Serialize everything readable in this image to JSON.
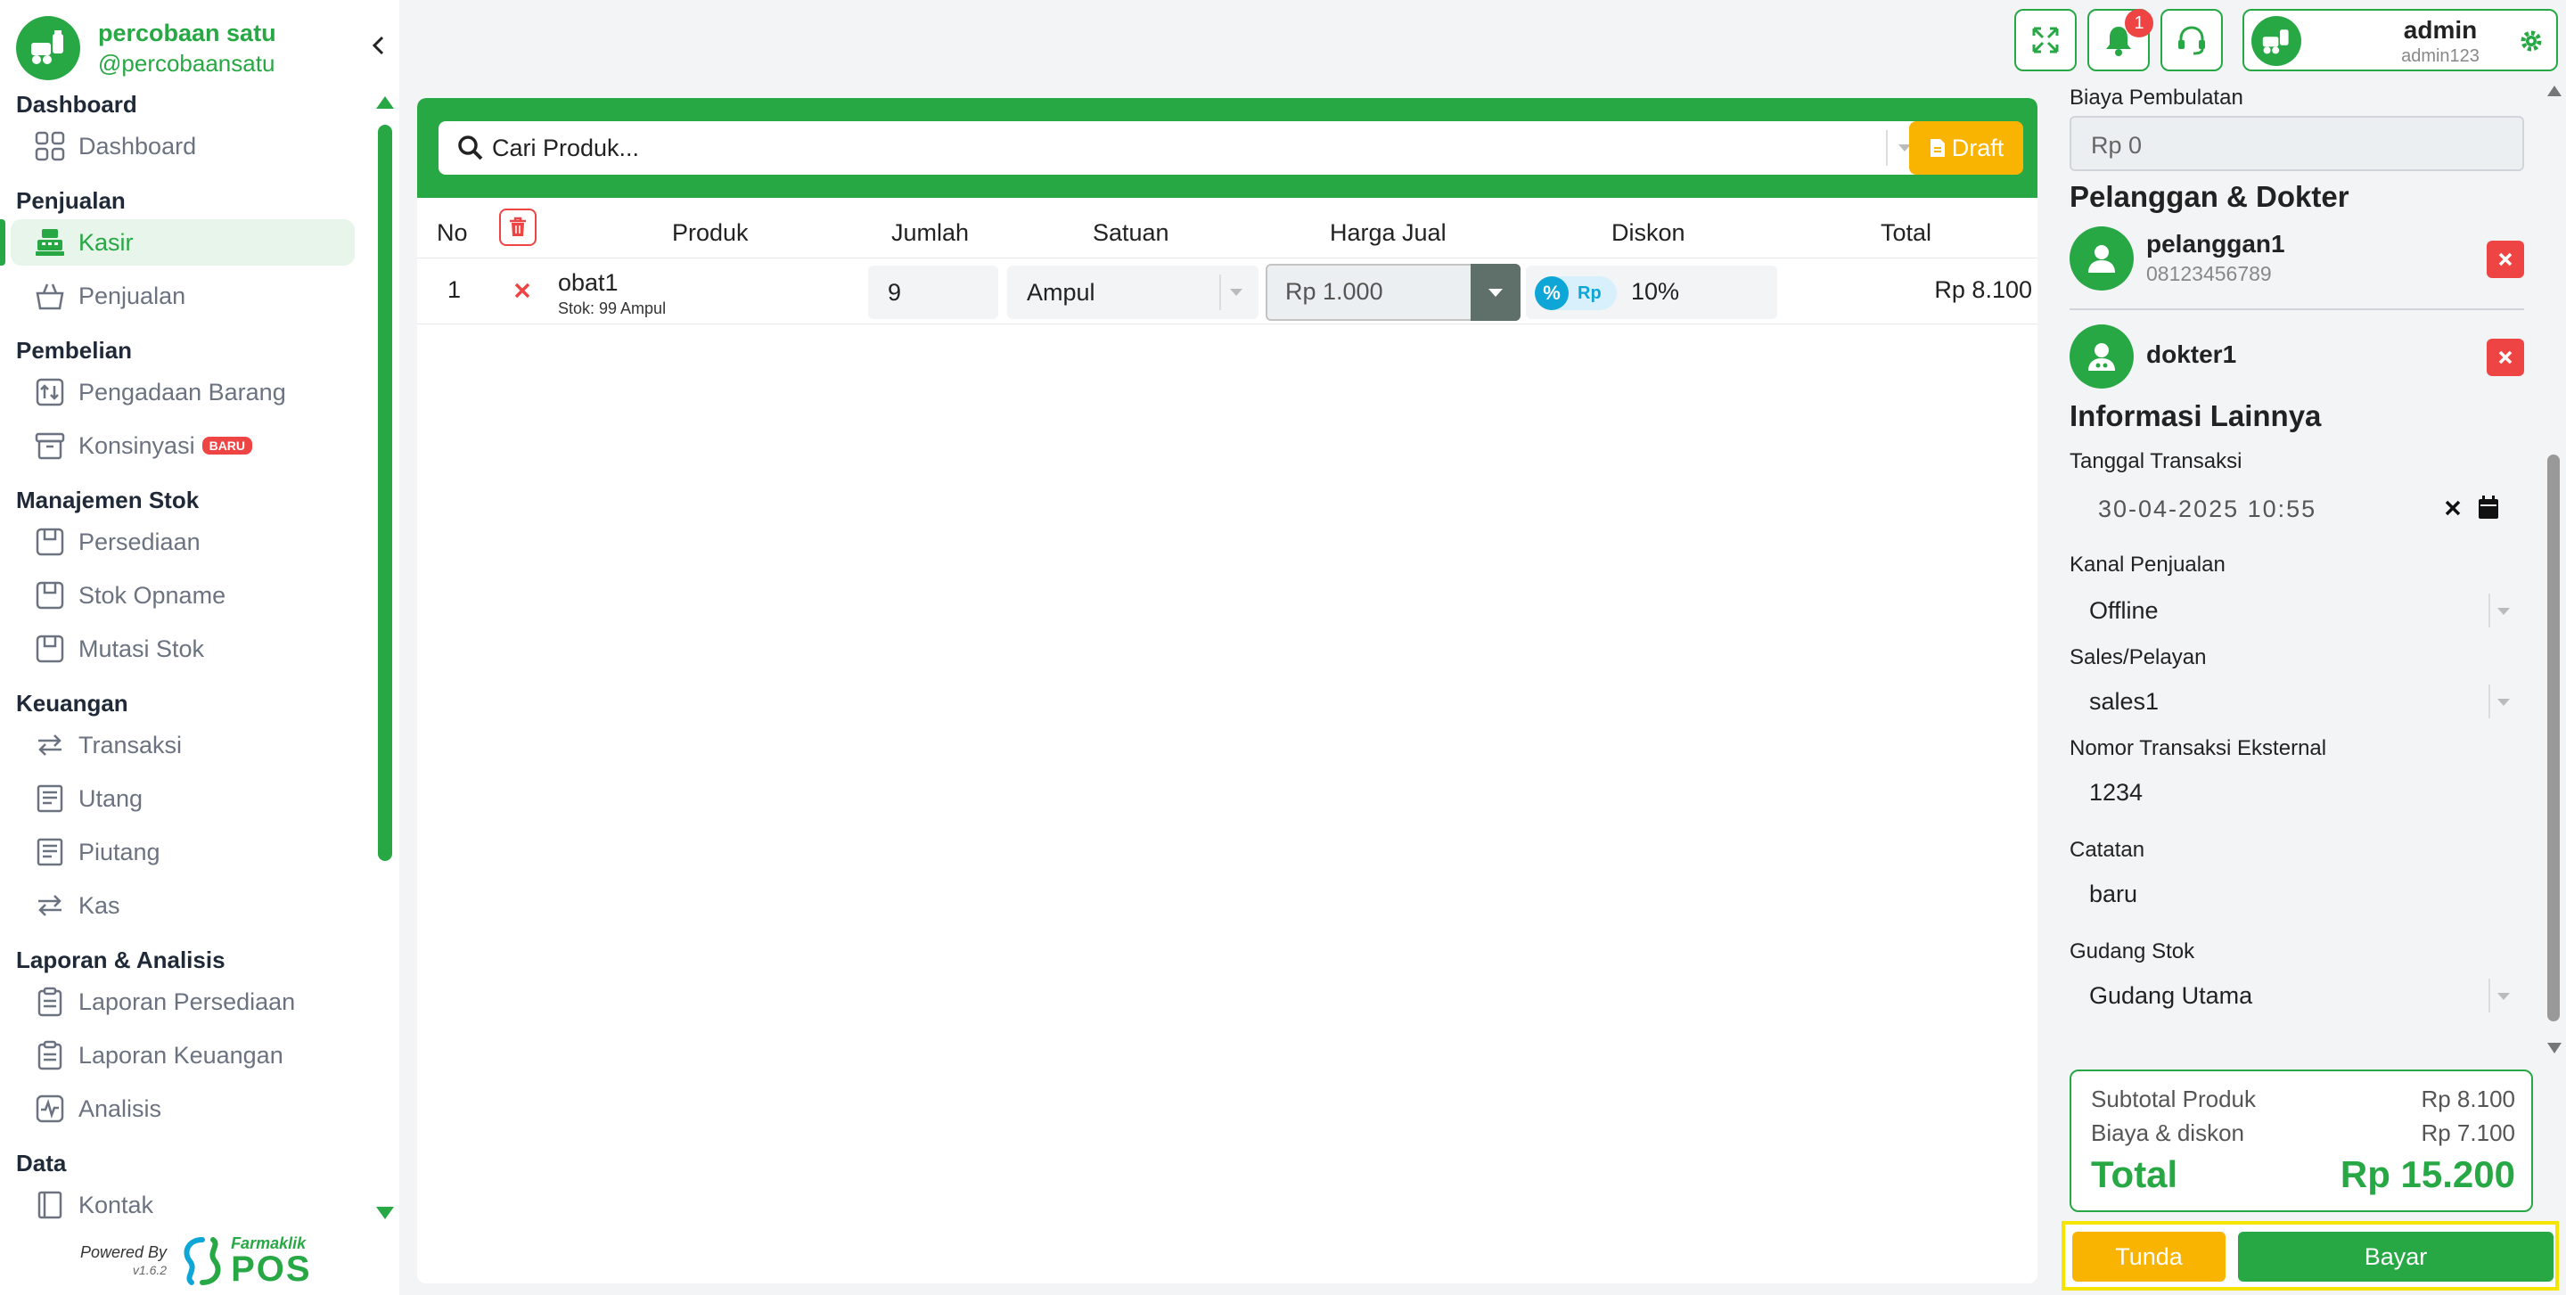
{
  "brand": {
    "name": "percobaan satu",
    "handle": "@percobaansatu"
  },
  "colors": {
    "primary": "#27a844",
    "warning": "#f8b400",
    "danger": "#ef4444",
    "info": "#0ea5d7"
  },
  "sidebar": {
    "sections": [
      {
        "title": "Dashboard",
        "items": [
          {
            "label": "Dashboard",
            "icon": "grid-icon"
          }
        ]
      },
      {
        "title": "Penjualan",
        "items": [
          {
            "label": "Kasir",
            "icon": "cash-register-icon",
            "active": true
          },
          {
            "label": "Penjualan",
            "icon": "basket-icon"
          }
        ]
      },
      {
        "title": "Pembelian",
        "items": [
          {
            "label": "Pengadaan Barang",
            "icon": "procurement-icon"
          },
          {
            "label": "Konsinyasi",
            "icon": "archive-icon",
            "badge": "BARU"
          }
        ]
      },
      {
        "title": "Manajemen Stok",
        "items": [
          {
            "label": "Persediaan",
            "icon": "box-icon"
          },
          {
            "label": "Stok Opname",
            "icon": "box-icon"
          },
          {
            "label": "Mutasi Stok",
            "icon": "box-icon"
          }
        ]
      },
      {
        "title": "Keuangan",
        "items": [
          {
            "label": "Transaksi",
            "icon": "transfer-icon"
          },
          {
            "label": "Utang",
            "icon": "receipt-icon"
          },
          {
            "label": "Piutang",
            "icon": "receipt-icon"
          },
          {
            "label": "Kas",
            "icon": "transfer-icon"
          }
        ]
      },
      {
        "title": "Laporan & Analisis",
        "items": [
          {
            "label": "Laporan Persediaan",
            "icon": "clipboard-icon"
          },
          {
            "label": "Laporan Keuangan",
            "icon": "clipboard-icon"
          },
          {
            "label": "Analisis",
            "icon": "activity-icon"
          }
        ]
      },
      {
        "title": "Data",
        "items": [
          {
            "label": "Kontak",
            "icon": "contact-book-icon"
          }
        ]
      }
    ],
    "powered_by": "Powered By",
    "version": "v1.6.2",
    "product_small": "Farmaklik",
    "product_big": "POS"
  },
  "topbar": {
    "notification_count": "1",
    "user_name": "admin",
    "user_id": "admin123"
  },
  "search": {
    "placeholder": "Cari Produk...",
    "draft_label": "Draft"
  },
  "table": {
    "headers": {
      "no": "No",
      "produk": "Produk",
      "jumlah": "Jumlah",
      "satuan": "Satuan",
      "harga": "Harga Jual",
      "diskon": "Diskon",
      "total": "Total"
    },
    "rows": [
      {
        "no": "1",
        "name": "obat1",
        "stock": "Stok: 99 Ampul",
        "qty": "9",
        "unit": "Ampul",
        "price": "Rp 1.000",
        "discount_pct": "%",
        "discount_rp": "Rp",
        "discount": "10%",
        "total": "Rp 8.100"
      }
    ]
  },
  "right": {
    "rounding_label": "Biaya Pembulatan",
    "rounding_value": "Rp 0",
    "customers_title": "Pelanggan & Dokter",
    "customer": {
      "name": "pelanggan1",
      "phone": "08123456789"
    },
    "doctor": {
      "name": "dokter1"
    },
    "other_title": "Informasi Lainnya",
    "date_label": "Tanggal Transaksi",
    "date_value": "30-04-2025 10:55",
    "channel_label": "Kanal Penjualan",
    "channel_value": "Offline",
    "sales_label": "Sales/Pelayan",
    "sales_value": "sales1",
    "ext_label": "Nomor Transaksi Eksternal",
    "ext_value": "1234",
    "note_label": "Catatan",
    "note_value": "baru",
    "warehouse_label": "Gudang Stok",
    "warehouse_value": "Gudang Utama"
  },
  "summary": {
    "subtotal_label": "Subtotal Produk",
    "subtotal_value": "Rp 8.100",
    "fees_label": "Biaya & diskon",
    "fees_value": "Rp 7.100",
    "total_label": "Total",
    "total_value": "Rp 15.200"
  },
  "actions": {
    "hold": "Tunda",
    "pay": "Bayar"
  }
}
